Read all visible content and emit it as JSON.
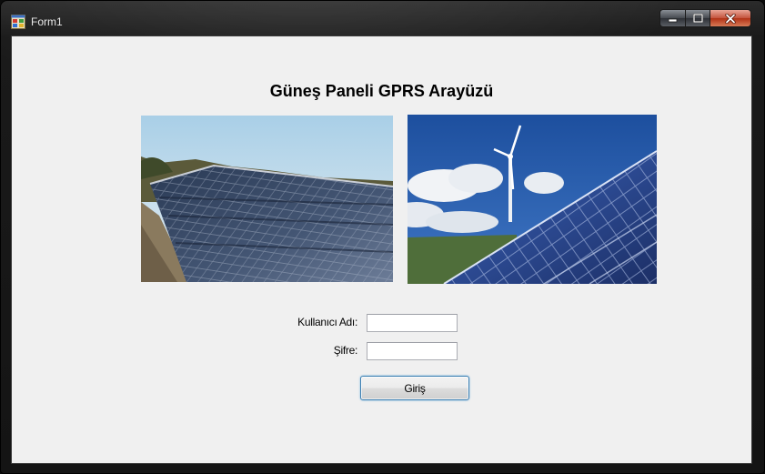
{
  "window": {
    "title": "Form1",
    "icon": "winforms-app-icon",
    "controls": [
      "minimize-icon",
      "maximize-icon",
      "close-icon"
    ]
  },
  "form": {
    "heading": "Güneş Paneli GPRS Arayüzü",
    "images": [
      "solar-panels-on-roof-photo",
      "solar-panels-wind-turbine-photo"
    ],
    "username_label": "Kullanıcı Adı:",
    "username_value": "",
    "password_label": "Şifre:",
    "password_value": "",
    "login_button": "Giriş"
  },
  "colors": {
    "client_bg": "#f0f0f0",
    "button_focus_border": "#3c7fb1",
    "close_button": "#c4533c"
  }
}
